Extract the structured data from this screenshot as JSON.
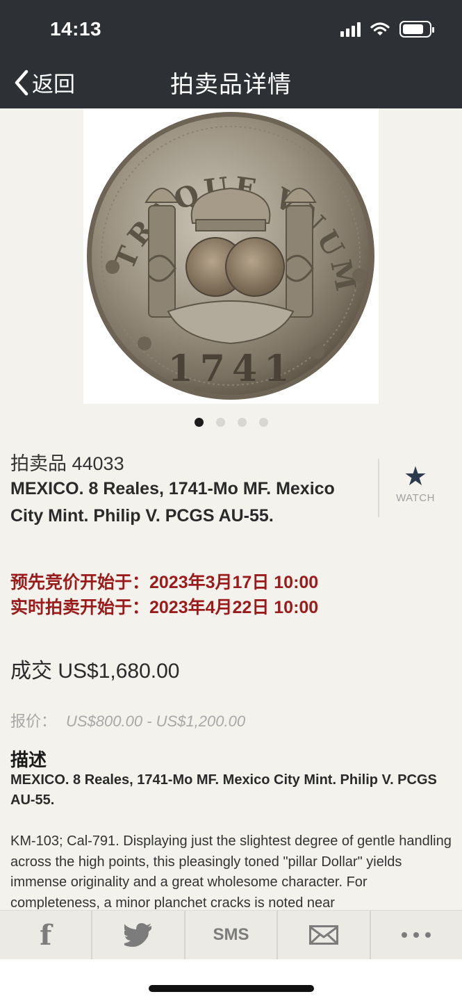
{
  "status": {
    "time": "14:13"
  },
  "nav": {
    "back_label": "返回",
    "title": "拍卖品详情"
  },
  "carousel": {
    "total": 4,
    "active": 1
  },
  "lot": {
    "number": "拍卖品 44033",
    "title": "MEXICO. 8 Reales, 1741-Mo MF. Mexico City Mint. Philip V. PCGS AU-55.",
    "watch_label": "WATCH",
    "advance_bid_start": "预先竞价开始于：2023年3月17日 10:00",
    "live_auction_start": "实时拍卖开始于：2023年4月22日 10:00",
    "sold": "成交 US$1,680.00",
    "estimate_label": "报价：",
    "estimate_range": "US$800.00 - US$1,200.00"
  },
  "description": {
    "heading": "描述",
    "title": "MEXICO. 8 Reales, 1741-Mo MF. Mexico City Mint. Philip V. PCGS AU-55.",
    "body": "KM-103; Cal-791. Displaying just the slightest degree of gentle handling across the high points, this pleasingly toned \"pillar Dollar\" yields immense originality and a great wholesome character. For completeness, a minor planchet cracks is noted near"
  },
  "coin_image": {
    "legend_top": "VTRAQUE VNUM",
    "date": "1741"
  },
  "share": {
    "sms_label": "SMS"
  },
  "colors": {
    "topbar": "#2d3136",
    "background": "#f3f2ed",
    "date_red": "#9b1b1b",
    "watch_star": "#2d3a4d"
  }
}
